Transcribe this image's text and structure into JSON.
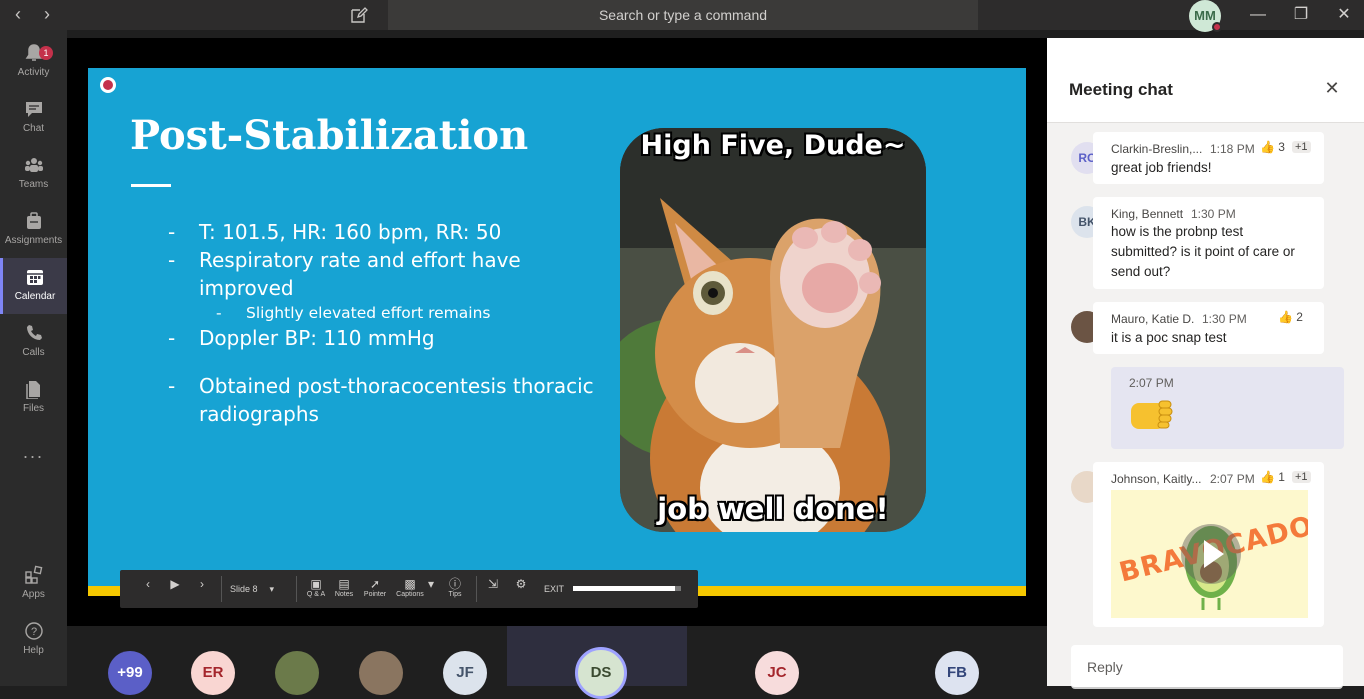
{
  "titlebar": {
    "search_placeholder": "Search or type a command",
    "user_initials": "MM",
    "icons": [
      "back-arrow-icon",
      "forward-arrow-icon",
      "compose-icon",
      "minimize-icon",
      "restore-icon",
      "close-icon"
    ]
  },
  "rail": {
    "items": [
      {
        "label": "Activity",
        "icon": "bell-icon",
        "badge": "1"
      },
      {
        "label": "Chat",
        "icon": "chat-icon"
      },
      {
        "label": "Teams",
        "icon": "teams-icon"
      },
      {
        "label": "Assignments",
        "icon": "assignments-icon"
      },
      {
        "label": "Calendar",
        "icon": "calendar-icon",
        "active": true
      },
      {
        "label": "Calls",
        "icon": "phone-icon"
      },
      {
        "label": "Files",
        "icon": "files-icon"
      },
      {
        "label": "Apps",
        "icon": "apps-icon"
      },
      {
        "label": "Help",
        "icon": "help-icon"
      }
    ],
    "more_label": "..."
  },
  "slide": {
    "title": "Post-Stabilization",
    "bullets": [
      {
        "text": "T: 101.5, HR: 160 bpm, RR: 50",
        "level": 1
      },
      {
        "text": "Respiratory rate and effort have improved",
        "level": 1
      },
      {
        "text": "Slightly elevated effort remains",
        "level": 2
      },
      {
        "text": "Doppler BP: 110 mmHg",
        "level": 1
      },
      {
        "text": "Obtained post-thoracocentesis thoracic radiographs",
        "level": 1
      }
    ],
    "meme_top": "High Five, Dude~",
    "meme_bottom": "job well done!",
    "accent_color": "#17a3d3"
  },
  "presenter_toolbar": {
    "slide_label": "Slide 8",
    "qa_label": "Q & A",
    "notes_label": "Notes",
    "pointer_label": "Pointer",
    "captions_label": "Captions",
    "tips_label": "Tips",
    "exit_label": "EXIT",
    "progress": 0.94
  },
  "gallery": {
    "participants": [
      {
        "initials": "+99",
        "color": "#5b5fc7",
        "text_color": "#ffffff"
      },
      {
        "initials": "ER",
        "color": "#f9d6d2",
        "text_color": "#a4262c"
      },
      {
        "initials": "",
        "color": "#6b7a4a",
        "text_color": "#ffffff"
      },
      {
        "initials": "",
        "color": "#8a7560",
        "text_color": "#ffffff"
      },
      {
        "initials": "JF",
        "color": "#dce3ec",
        "text_color": "#44546a"
      },
      {
        "initials": "DS",
        "color": "#d6e4d0",
        "text_color": "#3b4a30"
      },
      {
        "initials": "JC",
        "color": "#f7dcdc",
        "text_color": "#a4262c"
      },
      {
        "initials": "FB",
        "color": "#dde3f0",
        "text_color": "#33467a"
      }
    ]
  },
  "chat": {
    "title": "Meeting chat",
    "messages": [
      {
        "initials": "RC",
        "name": "Clarkin-Breslin,...",
        "time": "1:18 PM",
        "reaction": "3",
        "extra": "+1",
        "text": "great job friends!"
      },
      {
        "initials": "BK",
        "name": "King, Bennett",
        "time": "1:30 PM",
        "text_lines": [
          "how is the probnp test",
          "submitted? is it point of care or",
          "send out?"
        ]
      },
      {
        "initials": "",
        "name": "Mauro, Katie D.",
        "time": "1:30 PM",
        "reaction": "2",
        "text": "it is a poc snap test"
      },
      {
        "initials": "",
        "name": "Johnson, Kaitly...",
        "time": "2:07 PM",
        "reaction": "1",
        "extra": "+1",
        "sticker_text": "BRAVOCADO"
      }
    ],
    "my_message_time": "2:07 PM",
    "reply_placeholder": "Reply"
  }
}
